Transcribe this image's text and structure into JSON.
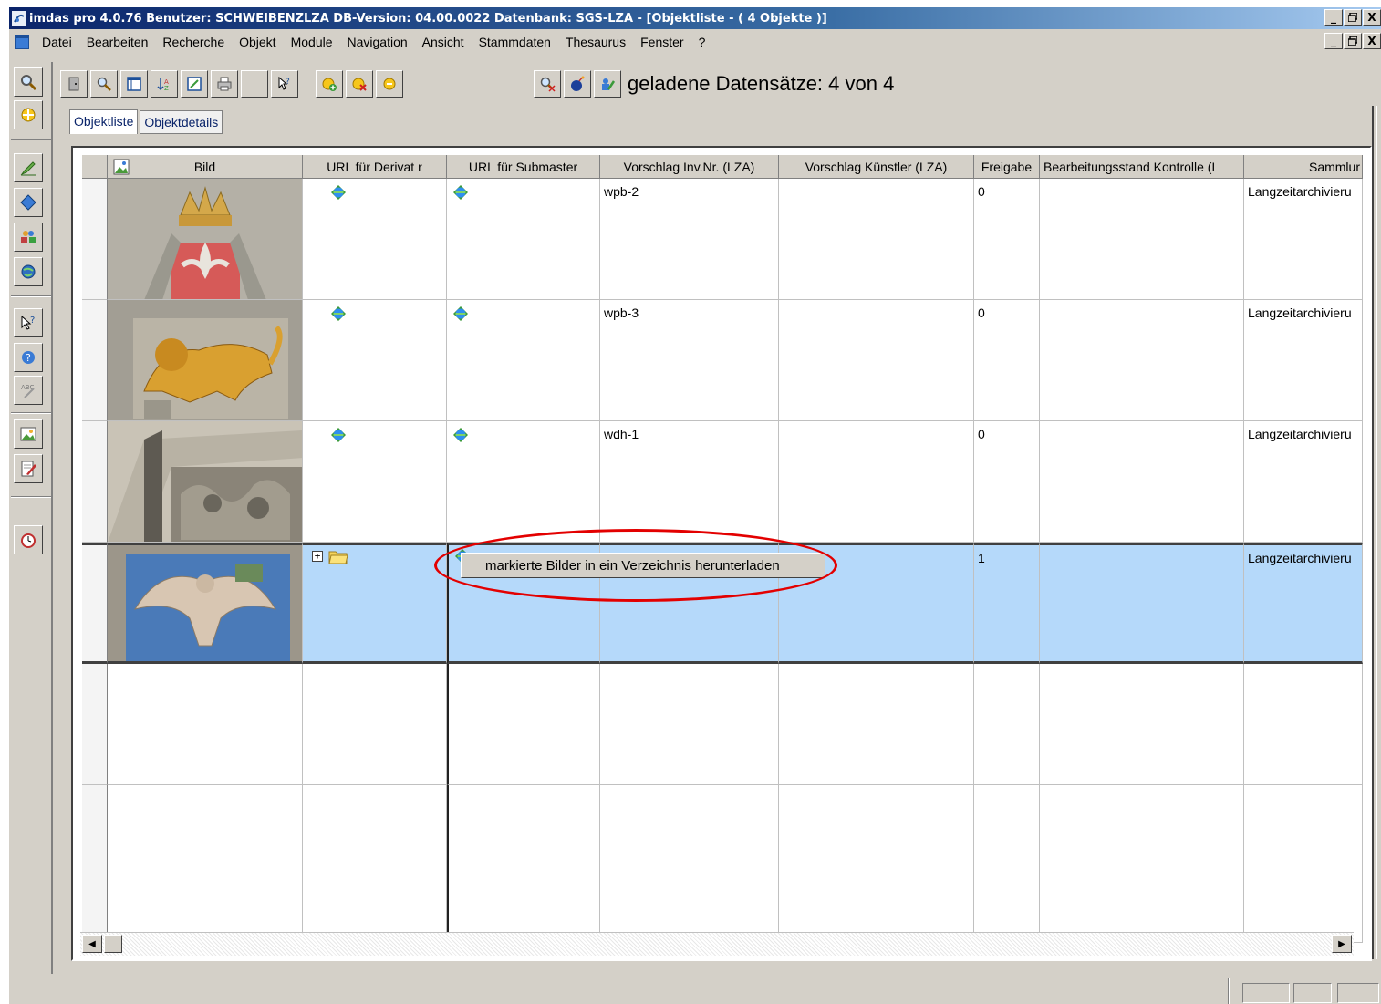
{
  "window": {
    "title": "imdas pro 4.0.76  Benutzer: SCHWEIBENZLZA  DB-Version: 04.00.0022  Datenbank: SGS-LZA - [Objektliste - ( 4 Objekte )]",
    "minimize": "_",
    "maximize": "Ɖ",
    "close": "X"
  },
  "menu": {
    "items": [
      "Datei",
      "Bearbeiten",
      "Recherche",
      "Objekt",
      "Module",
      "Navigation",
      "Ansicht",
      "Stammdaten",
      "Thesaurus",
      "Fenster",
      "?"
    ]
  },
  "toolbar": {
    "loaded_text": "geladene Datensätze: 4 von 4"
  },
  "tabs": [
    {
      "label": "Objektliste",
      "active": true
    },
    {
      "label": "Objektdetails",
      "active": false
    }
  ],
  "grid": {
    "columns": [
      "",
      "Bild",
      "URL für Derivat r",
      "URL für Submaster",
      "Vorschlag Inv.Nr. (LZA)",
      "Vorschlag Künstler (LZA)",
      "Freigabe",
      "Bearbeitungsstand Kontrolle (L",
      "Sammlur"
    ],
    "rows": [
      {
        "image": "crown-fleur-de-lis-relief",
        "inv": "wpb-2",
        "freigabe": "0",
        "sammlung": "Langzeitarchivieru",
        "selected": false
      },
      {
        "image": "golden-lion-relief",
        "inv": "wpb-3",
        "freigabe": "0",
        "sammlung": "Langzeitarchivieru",
        "selected": false
      },
      {
        "image": "carved-ornament-panel",
        "inv": "wdh-1",
        "freigabe": "0",
        "sammlung": "Langzeitarchivieru",
        "selected": false
      },
      {
        "image": "eagle-relief",
        "inv": "",
        "freigabe": "1",
        "sammlung": "Langzeitarchivieru",
        "selected": true
      }
    ]
  },
  "context_menu": {
    "item": "markierte Bilder in ein Verzeichnis herunterladen"
  },
  "colors": {
    "selection": "#b5d9fa",
    "highlight": "#e30000",
    "title_gradient_start": "#0a246a"
  }
}
